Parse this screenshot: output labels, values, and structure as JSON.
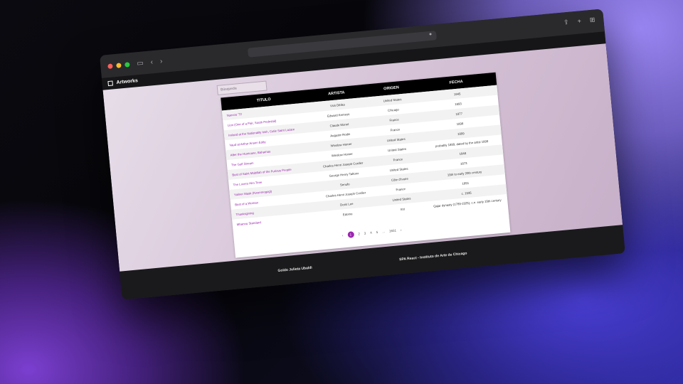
{
  "browser": {
    "url": ""
  },
  "app": {
    "title": "Artworks"
  },
  "search": {
    "placeholder": "Búsqueda"
  },
  "table": {
    "headers": [
      "TITULO",
      "ARTISTA",
      "ORIGEN",
      "FECHA"
    ],
    "rows": [
      [
        "Nuevos '72",
        "Vick Dibiks",
        "United States",
        "1945"
      ],
      [
        "Lion (One of a Pair, South Pedestal)",
        "Edward Kemeys",
        "Chicago",
        "1893"
      ],
      [
        "Ireland at the Nationality Irish, Cutie Saint Lazare",
        "Claude Monet",
        "France",
        "1877"
      ],
      [
        "Vaud at Arthur Ansen Eddy",
        "Auguste Rodin",
        "France",
        "1898"
      ],
      [
        "After the Hurricane, Bahamas",
        "Winslow Homer",
        "United States",
        "1899"
      ],
      [
        "The Gulf Stream",
        "Winslow Homer",
        "United States",
        "probably 1899, dated by the artist 1899"
      ],
      [
        "Bust of Saint Mabillah of the Furious People",
        "Charles Henri Joseph Cordier",
        "France",
        "1848"
      ],
      [
        "The Lovers Him Time",
        "George Henry Taltonx",
        "United States",
        "1873"
      ],
      [
        "Yaliner Mask (Kwonmogogi)",
        "Senufo",
        "Côte d'Ivoire",
        "19th to early 20th century"
      ],
      [
        "Bust of a Woman",
        "Charles Henri Joseph Cordier",
        "France",
        "1851"
      ],
      [
        "Thanksgiving",
        "Doris Lee",
        "United States",
        "c. 1935"
      ],
      [
        "Mbannu Standard",
        "Edomo",
        "Irst",
        "Qajar dynasty (1789-1925), c.e. early 19th century"
      ]
    ]
  },
  "pager": {
    "prev": "‹",
    "pages": [
      "1",
      "2",
      "3",
      "4",
      "5"
    ],
    "ellipsis": "...",
    "last": "1651",
    "next": "›"
  },
  "footer": {
    "left": "Goldo Julieta Ubaldi",
    "right": "SPA React - Instituto de Arte de Chicago"
  }
}
